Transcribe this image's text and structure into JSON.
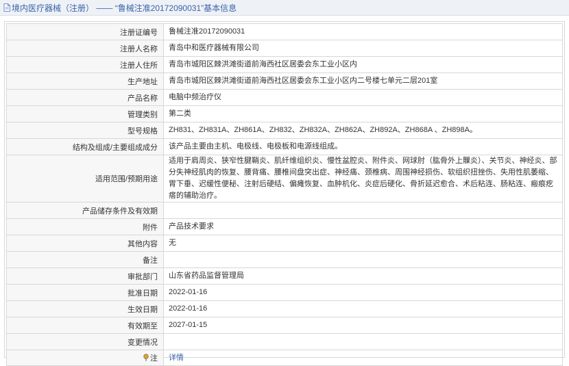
{
  "header": {
    "title_prefix": "境内医疗器械（注册）",
    "separator": "——",
    "title_detail": "“鲁械注准20172090031”基本信息"
  },
  "rows": [
    {
      "label": "注册证编号",
      "value": "鲁械注准20172090031"
    },
    {
      "label": "注册人名称",
      "value": "青岛中和医疗器械有限公司"
    },
    {
      "label": "注册人住所",
      "value": "青岛市城阳区棘洪滩街道前海西社区居委会东工业小区内"
    },
    {
      "label": "生产地址",
      "value": "青岛市城阳区棘洪滩街道前海西社区居委会东工业小区内二号楼七单元二层201室"
    },
    {
      "label": "产品名称",
      "value": "电脑中频治疗仪"
    },
    {
      "label": "管理类别",
      "value": "第二类"
    },
    {
      "label": "型号规格",
      "value": "ZH831、ZH831A、ZH861A、ZH832、ZH832A、ZH862A、ZH892A、ZH868A 、ZH898A。"
    },
    {
      "label": "结构及组成/主要组成成分",
      "value": "该产品主要由主机、电极线、电极板和电源线组成。"
    },
    {
      "label": "适用范围/预期用途",
      "value": "适用于肩周炎、狭窄性腱鞘炎、肌纤维组织炎、慢性盆腔炎、附件炎、网球肘（肱骨外上髁炎）、关节炎、神经炎、部分失神经肌肉的恢复、腰背痛、腰椎间盘突出症、神经痛、颈椎病、周围神经损伤、软组织扭挫伤、失用性肌萎缩、胃下垂、迟缓性便秘、注射后硬结、偏瘫恢复、血肿机化、炎症后硬化、骨折延迟愈合、术后粘连、肠粘连、瘢痕疙瘩的辅助治疗。"
    },
    {
      "label": "产品储存条件及有效期",
      "value": ""
    },
    {
      "label": "附件",
      "value": "产品技术要求"
    },
    {
      "label": "其他内容",
      "value": "无"
    },
    {
      "label": "备注",
      "value": ""
    },
    {
      "label": "审批部门",
      "value": "山东省药品监督管理局"
    },
    {
      "label": "批准日期",
      "value": "2022-01-16"
    },
    {
      "label": "生效日期",
      "value": "2022-01-16"
    },
    {
      "label": "有效期至",
      "value": "2027-01-15"
    },
    {
      "label": "变更情况",
      "value": ""
    }
  ],
  "note_row": {
    "label": "注",
    "link_text": "详情"
  },
  "colors": {
    "link": "#3a64a8",
    "label_bg": "#f7f7f7",
    "border": "#d7d7d7",
    "header_bg": "#eef1f6"
  },
  "icons": {
    "header": "document-icon",
    "note": "pin-icon"
  }
}
